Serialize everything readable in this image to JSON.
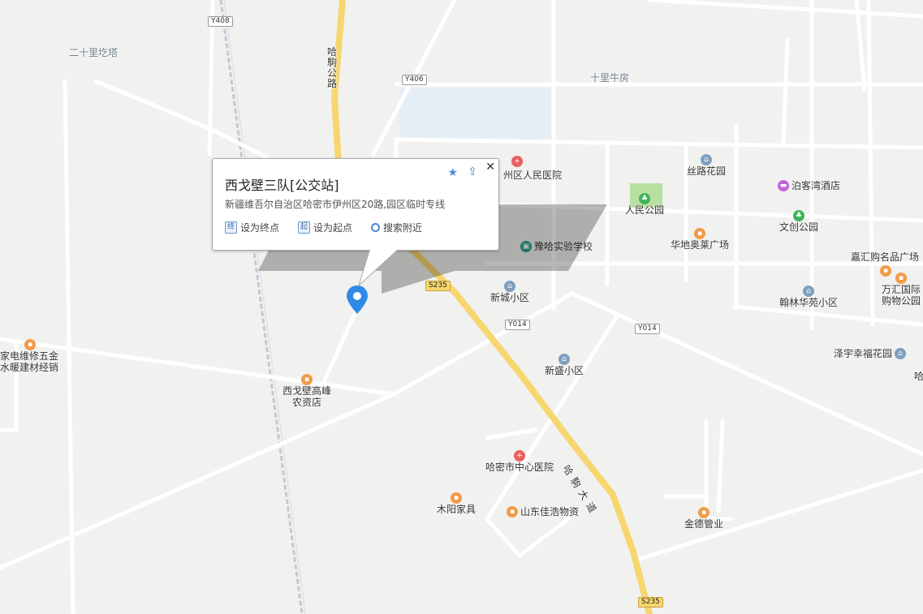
{
  "map": {
    "road_labels": {
      "hahu_road": "哈駒公路",
      "hahu_avenue": "哈駒大道",
      "y408": "Y408",
      "y406": "Y406",
      "y014_a": "Y014",
      "y014_b": "Y014",
      "s235_a": "S235",
      "s235_b": "S235"
    },
    "areas": {
      "ershili": "二十里圪塔",
      "shili": "十里牛房"
    },
    "pois": {
      "yizhou_hospital": "州区人民医院",
      "silu_garden": "丝路花园",
      "renmin_park": "人民公园",
      "boke_hotel": "泊客湾酒店",
      "wenchuang_park": "文创公园",
      "yuha_school": "豫哈实验学校",
      "huadi_plaza": "华地奥莱广场",
      "jiahui_plaza": "嘉汇购名品广场",
      "wanhui": "万汇国际\n购物公园",
      "hanlin": "翰林华苑小区",
      "xincheng": "新城小区",
      "zeyu": "泽宇幸福花园",
      "ha_edge": "哈",
      "appliance": "家电维修五金\n水暖建材经销",
      "xigebi_shop": "西戈壁高峰\n农资店",
      "xinsheng": "新盛小区",
      "central_hospital": "哈密市中心医院",
      "muyang": "木阳家具",
      "shandong": "山东佳浩物资",
      "jinde": "金德管业"
    }
  },
  "popup": {
    "title": "西戈壁三队[公交站]",
    "address": "新疆维吾尔自治区哈密市伊州区20路,园区临时专线",
    "actions": {
      "set_end": "设为终点",
      "set_start": "设为起点",
      "search_nearby": "搜索附近"
    },
    "action_icons": {
      "end": "终",
      "start": "起"
    }
  },
  "icons": {
    "marker": "location-pin-icon",
    "star": "star-icon",
    "share": "share-icon",
    "close": "close-icon"
  },
  "colors": {
    "main_road": "#f7d66f",
    "roads": "#ffffff",
    "marker": "#2f8ae6",
    "water_area": "#e6eef5"
  }
}
